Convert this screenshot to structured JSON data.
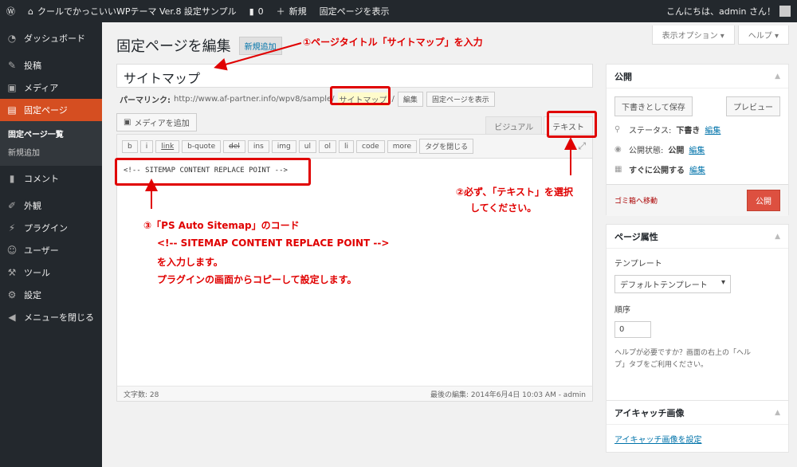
{
  "adminbar": {
    "site_name": "クールでかっこいいWPテーマ Ver.8 設定サンプル",
    "comments_count": "0",
    "new_label": "新規",
    "view_page": "固定ページを表示",
    "greeting": "こんにちは、admin さん！"
  },
  "sidebar": {
    "items": [
      {
        "label": "ダッシュボード"
      },
      {
        "label": "投稿"
      },
      {
        "label": "メディア"
      },
      {
        "label": "固定ページ"
      },
      {
        "label": "コメント"
      },
      {
        "label": "外観"
      },
      {
        "label": "プラグイン"
      },
      {
        "label": "ユーザー"
      },
      {
        "label": "ツール"
      },
      {
        "label": "設定"
      },
      {
        "label": "メニューを閉じる"
      }
    ],
    "submenu": [
      "固定ページ一覧",
      "新規追加"
    ]
  },
  "screen_options": {
    "options": "表示オプション ▾",
    "help": "ヘルプ ▾"
  },
  "header": {
    "title": "固定ページを編集",
    "add_new": "新規追加"
  },
  "post": {
    "title": "サイトマップ",
    "permalink_label": "パーマリンク:",
    "permalink_base": "http://www.af-partner.info/wpv8/sample/",
    "permalink_slug": "サイトマップ",
    "permalink_end": "/",
    "edit_btn": "編集",
    "view_btn": "固定ページを表示"
  },
  "editor": {
    "add_media": "メディアを追加",
    "tab_visual": "ビジュアル",
    "tab_text": "テキスト",
    "buttons": [
      "b",
      "i",
      "link",
      "b-quote",
      "del",
      "ins",
      "img",
      "ul",
      "ol",
      "li",
      "code",
      "more",
      "タグを閉じる"
    ],
    "content": "<!-- SITEMAP CONTENT REPLACE POINT -->",
    "word_count": "文字数: 28",
    "last_edit": "最後の編集: 2014年6月4日 10:03 AM - admin"
  },
  "publish": {
    "title": "公開",
    "save_draft": "下書きとして保存",
    "preview": "プレビュー",
    "status_label": "ステータス:",
    "status_value": "下書き",
    "visibility_label": "公開状態:",
    "visibility_value": "公開",
    "schedule_label": "すぐに公開する",
    "edit_link": "編集",
    "trash": "ゴミ箱へ移動",
    "publish_btn": "公開"
  },
  "page_attributes": {
    "title": "ページ属性",
    "template_label": "テンプレート",
    "template_value": "デフォルトテンプレート",
    "order_label": "順序",
    "order_value": "0",
    "help_text_1": "ヘルプが必要ですか？画面の右上の「ヘル",
    "help_text_2": "プ」タブをご利用ください。"
  },
  "featured_image": {
    "title": "アイキャッチ画像",
    "link": "アイキャッチ画像を設定"
  },
  "annotations": {
    "a1": "①ページタイトル「サイトマップ」を入力",
    "a2_line1": "②必ず、「テキスト」を選択",
    "a2_line2": "してください。",
    "a3_line1": "③「PS Auto Sitemap」のコード",
    "a3_line2": "<!-- SITEMAP CONTENT REPLACE POINT -->",
    "a3_line3": "を入力します。",
    "a3_line4": "プラグインの画面からコピーして設定します。"
  },
  "colors": {
    "accent": "#d54e21",
    "annotation": "#e00000",
    "adminbar": "#23282d",
    "link": "#0073aa"
  }
}
